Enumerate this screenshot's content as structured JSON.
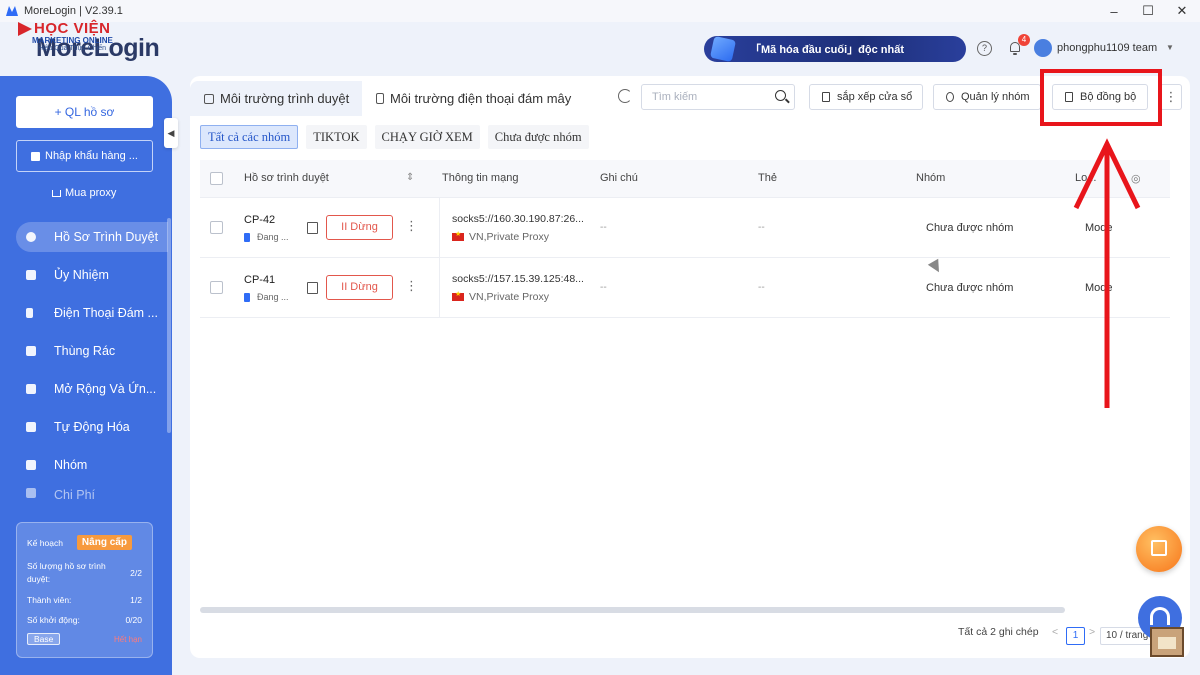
{
  "window": {
    "title": "MoreLogin | V2.39.1",
    "controls": {
      "minimize": "–",
      "maximize": "☐",
      "close": "✕"
    }
  },
  "watermark": {
    "line1": "HỌC VIỆN",
    "line2": "MARKETING ONLINE",
    "line3": "Hiệu Quả Thực Chiến"
  },
  "header": {
    "logo": "MoreLogin",
    "banner": "「Mã hóa đầu cuối」độc nhất",
    "help_icon": "?",
    "notification_count": "4",
    "team_name": "phongphu1109 team",
    "team_caret": "▼"
  },
  "sidebar": {
    "new_profile": "+ QL hồ sơ",
    "import": "Nhập khẩu hàng ...",
    "buy_proxy": "Mua proxy",
    "collapse_icon": "◀",
    "items": [
      {
        "label": "Hồ Sơ Trình Duyệt",
        "icon": "browser-icon",
        "active": true
      },
      {
        "label": "Ủy Nhiệm",
        "icon": "proxy-icon"
      },
      {
        "label": "Điện Thoại Đám ...",
        "icon": "phone-icon"
      },
      {
        "label": "Thùng Rác",
        "icon": "trash-icon"
      },
      {
        "label": "Mở Rộng Và Ứn...",
        "icon": "puzzle-icon"
      },
      {
        "label": "Tự Động Hóa",
        "icon": "automation-icon"
      },
      {
        "label": "Nhóm",
        "icon": "group-icon"
      },
      {
        "label": "Chi Phí",
        "icon": "cost-icon"
      }
    ],
    "plan": {
      "plan_label": "Kế hoạch",
      "upgrade": "Nâng cấp",
      "profiles_label_1": "Số lượng hồ sơ trình",
      "profiles_label_2": "duyệt:",
      "profiles_value": "2/2",
      "members_label": "Thành viên:",
      "members_value": "1/2",
      "launches_label": "Số khởi động:",
      "launches_value": "0/20",
      "base": "Base",
      "expired": "Hết hạn"
    }
  },
  "main": {
    "tabs": [
      {
        "label": "Môi trường trình duyệt",
        "active": true
      },
      {
        "label": "Môi trường điện thoại đám mây",
        "active": false
      }
    ],
    "search_placeholder": "Tìm kiếm",
    "toolbar": {
      "arrange_windows": "sắp xếp cửa sổ",
      "manage_groups": "Quản lý nhóm",
      "synchronizer": "Bộ đồng bộ",
      "more": "⋮"
    },
    "filters": [
      {
        "label": "Tất cả các nhóm",
        "active": true
      },
      {
        "label": "TIKTOK",
        "active": false
      },
      {
        "label": "CHẠY GIỜ XEM",
        "active": false
      },
      {
        "label": "Chưa được nhóm",
        "active": false
      }
    ],
    "columns": {
      "profile": "Hồ sơ trình duyệt",
      "network": "Thông tin mạng",
      "note": "Ghi chú",
      "tag": "Thẻ",
      "group": "Nhóm",
      "type": "Lo...",
      "sort_icon": "⇕",
      "settings_icon": "◎"
    },
    "rows": [
      {
        "name": "CP-42",
        "status": "Đang ...",
        "stop": "II Dừng",
        "more": "⋮",
        "proxy": "socks5://160.30.190.87:26...",
        "proxy_type": "VN,Private Proxy",
        "note": "--",
        "tag": "--",
        "group": "Chưa được nhóm",
        "type": "Mode"
      },
      {
        "name": "CP-41",
        "status": "Đang ...",
        "stop": "II Dừng",
        "more": "⋮",
        "proxy": "socks5://157.15.39.125:48...",
        "proxy_type": "VN,Private Proxy",
        "note": "--",
        "tag": "--",
        "group": "Chưa được nhóm",
        "type": "Mode"
      }
    ],
    "pagination": {
      "total": "Tất cả 2 ghi chép",
      "prev": "<",
      "page": "1",
      "next": ">",
      "per_page": "10 / trang"
    }
  },
  "annotation": {
    "color": "#e8151b"
  }
}
